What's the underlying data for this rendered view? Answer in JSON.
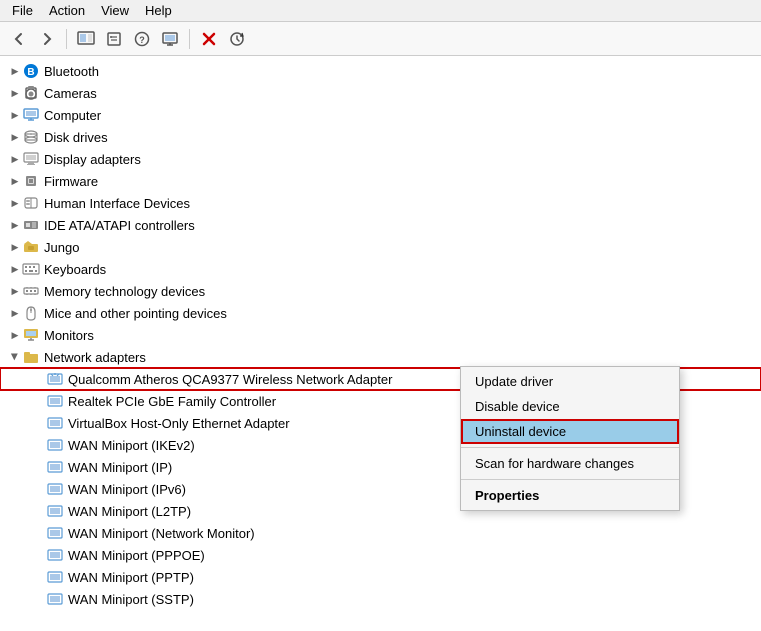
{
  "menubar": {
    "items": [
      "File",
      "Action",
      "View",
      "Help"
    ]
  },
  "toolbar": {
    "buttons": [
      {
        "name": "back",
        "icon": "◀",
        "disabled": false
      },
      {
        "name": "forward",
        "icon": "▶",
        "disabled": false
      },
      {
        "name": "up",
        "icon": "⬆",
        "disabled": false
      },
      {
        "name": "show-hidden",
        "icon": "🖥",
        "disabled": false
      },
      {
        "name": "properties",
        "icon": "📋",
        "disabled": false
      },
      {
        "name": "help",
        "icon": "❓",
        "disabled": false
      },
      {
        "name": "scan",
        "icon": "🔲",
        "disabled": false
      },
      {
        "name": "uninstall",
        "icon": "✖",
        "disabled": false
      },
      {
        "name": "update",
        "icon": "⬇",
        "disabled": false
      }
    ]
  },
  "tree": {
    "items": [
      {
        "id": "bluetooth",
        "label": "Bluetooth",
        "icon": "bluetooth",
        "expanded": false,
        "level": 0
      },
      {
        "id": "cameras",
        "label": "Cameras",
        "icon": "camera",
        "expanded": false,
        "level": 0
      },
      {
        "id": "computer",
        "label": "Computer",
        "icon": "computer",
        "expanded": false,
        "level": 0
      },
      {
        "id": "disk-drives",
        "label": "Disk drives",
        "icon": "disk",
        "expanded": false,
        "level": 0
      },
      {
        "id": "display-adapters",
        "label": "Display adapters",
        "icon": "display",
        "expanded": false,
        "level": 0
      },
      {
        "id": "firmware",
        "label": "Firmware",
        "icon": "firmware",
        "expanded": false,
        "level": 0
      },
      {
        "id": "human-interface",
        "label": "Human Interface Devices",
        "icon": "hid",
        "expanded": false,
        "level": 0
      },
      {
        "id": "ide",
        "label": "IDE ATA/ATAPI controllers",
        "icon": "ide",
        "expanded": false,
        "level": 0
      },
      {
        "id": "jungo",
        "label": "Jungo",
        "icon": "jungo",
        "expanded": false,
        "level": 0
      },
      {
        "id": "keyboards",
        "label": "Keyboards",
        "icon": "keyboard",
        "expanded": false,
        "level": 0
      },
      {
        "id": "memory-tech",
        "label": "Memory technology devices",
        "icon": "memory",
        "expanded": false,
        "level": 0
      },
      {
        "id": "mice",
        "label": "Mice and other pointing devices",
        "icon": "mouse",
        "expanded": false,
        "level": 0
      },
      {
        "id": "monitors",
        "label": "Monitors",
        "icon": "monitor",
        "expanded": false,
        "level": 0
      },
      {
        "id": "network-adapters",
        "label": "Network adapters",
        "icon": "network-folder",
        "expanded": true,
        "level": 0
      },
      {
        "id": "qualcomm",
        "label": "Qualcomm Atheros QCA9377 Wireless Network Adapter",
        "icon": "network",
        "level": 1,
        "highlighted": true
      },
      {
        "id": "realtek",
        "label": "Realtek PCIe GbE Family Controller",
        "icon": "network",
        "level": 1
      },
      {
        "id": "virtualbox",
        "label": "VirtualBox Host-Only Ethernet Adapter",
        "icon": "network",
        "level": 1
      },
      {
        "id": "wan-ikev2",
        "label": "WAN Miniport (IKEv2)",
        "icon": "network",
        "level": 1
      },
      {
        "id": "wan-ip",
        "label": "WAN Miniport (IP)",
        "icon": "network",
        "level": 1
      },
      {
        "id": "wan-ipv6",
        "label": "WAN Miniport (IPv6)",
        "icon": "network",
        "level": 1
      },
      {
        "id": "wan-l2tp",
        "label": "WAN Miniport (L2TP)",
        "icon": "network",
        "level": 1
      },
      {
        "id": "wan-netmon",
        "label": "WAN Miniport (Network Monitor)",
        "icon": "network",
        "level": 1
      },
      {
        "id": "wan-pppoe",
        "label": "WAN Miniport (PPPOE)",
        "icon": "network",
        "level": 1
      },
      {
        "id": "wan-pptp",
        "label": "WAN Miniport (PPTP)",
        "icon": "network",
        "level": 1
      },
      {
        "id": "wan-sstp",
        "label": "WAN Miniport (SSTP)",
        "icon": "network",
        "level": 1
      }
    ]
  },
  "context_menu": {
    "items": [
      {
        "id": "update-driver",
        "label": "Update driver",
        "active": false,
        "bold": false,
        "separator_after": false
      },
      {
        "id": "disable-device",
        "label": "Disable device",
        "active": false,
        "bold": false,
        "separator_after": false
      },
      {
        "id": "uninstall-device",
        "label": "Uninstall device",
        "active": true,
        "bold": false,
        "separator_after": true
      },
      {
        "id": "scan-hardware",
        "label": "Scan for hardware changes",
        "active": false,
        "bold": false,
        "separator_after": true
      },
      {
        "id": "properties",
        "label": "Properties",
        "active": false,
        "bold": true,
        "separator_after": false
      }
    ]
  }
}
